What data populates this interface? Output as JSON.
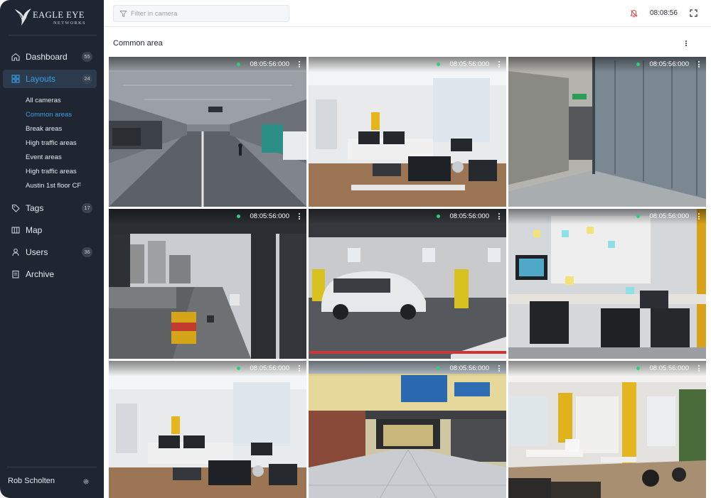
{
  "brand": {
    "name_line1": "EAGLE EYE",
    "name_line2": "NETWORKS"
  },
  "sidebar": {
    "nav": [
      {
        "id": "dashboard",
        "label": "Dashboard",
        "badge": "55",
        "icon": "home-icon"
      },
      {
        "id": "layouts",
        "label": "Layouts",
        "badge": "24",
        "icon": "layouts-icon",
        "active": true
      },
      {
        "id": "tags",
        "label": "Tags",
        "badge": "17",
        "icon": "tag-icon"
      },
      {
        "id": "map",
        "label": "Map",
        "icon": "map-icon"
      },
      {
        "id": "users",
        "label": "Users",
        "badge": "36",
        "icon": "user-icon"
      },
      {
        "id": "archive",
        "label": "Archive",
        "icon": "archive-icon"
      }
    ],
    "layouts_sub": [
      {
        "label": "All cameras"
      },
      {
        "label": "Common areas",
        "active": true
      },
      {
        "label": "Break areas"
      },
      {
        "label": "High traffic areas"
      },
      {
        "label": "Event areas"
      },
      {
        "label": "High traffic areas"
      },
      {
        "label": "Austin 1st floor CF"
      }
    ],
    "user": {
      "name": "Rob Scholten",
      "icon": "gear-icon"
    }
  },
  "topbar": {
    "filter_placeholder": "Filter in camera",
    "filter_value": "",
    "clock": "08:08:56",
    "icons": [
      "filter-icon",
      "bell-muted-icon",
      "fullscreen-icon"
    ]
  },
  "layout": {
    "title": "Common area",
    "cameras": [
      {
        "time": "08:05:56:000",
        "status": "online"
      },
      {
        "time": "08:05:56:000",
        "status": "online"
      },
      {
        "time": "08:05:56:000",
        "status": "online"
      },
      {
        "time": "08:05:56:000",
        "status": "online"
      },
      {
        "time": "08:05:56:000",
        "status": "online"
      },
      {
        "time": "08:05:56:000",
        "status": "online"
      },
      {
        "time": "08:05:56:000",
        "status": "online"
      },
      {
        "time": "08:05:56:000",
        "status": "online"
      },
      {
        "time": "08:05:56:000",
        "status": "online"
      }
    ]
  },
  "colors": {
    "sidebar_bg": "#1f2632",
    "accent": "#3aa0e8",
    "status_online": "#2bd07a"
  }
}
